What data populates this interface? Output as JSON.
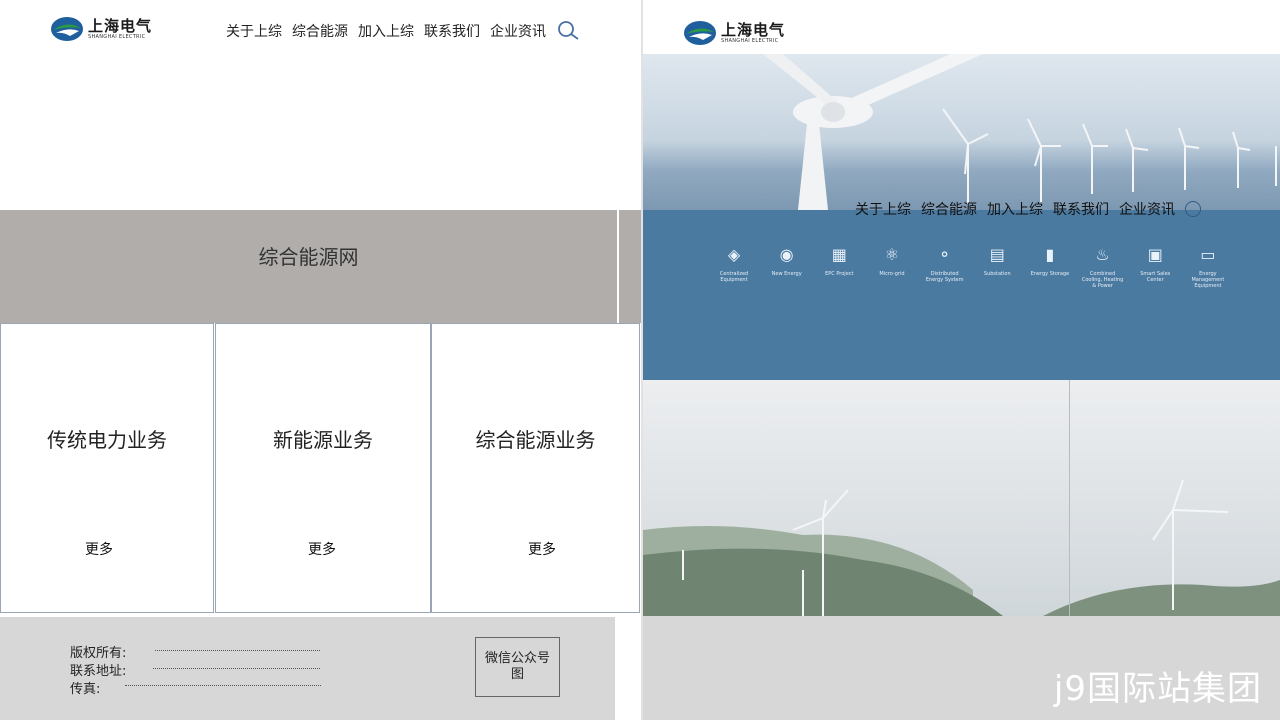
{
  "logo": {
    "cn": "上海电气",
    "en": "SHANGHAI ELECTRIC"
  },
  "nav": {
    "items": [
      "关于上综",
      "综合能源",
      "加入上综",
      "联系我们",
      "企业资讯"
    ]
  },
  "left": {
    "banner_title": "综合能源网",
    "cards": [
      {
        "title": "传统电力业务",
        "more": "更多"
      },
      {
        "title": "新能源业务",
        "more": "更多"
      },
      {
        "title": "综合能源业务",
        "more": "更多"
      }
    ],
    "footer": {
      "copyright_label": "版权所有:",
      "address_label": "联系地址:",
      "fax_label": "传真:",
      "qr_label": "微信公众号图"
    }
  },
  "right": {
    "services": [
      {
        "label": "Centralized Equipment"
      },
      {
        "label": "New Energy"
      },
      {
        "label": "EPC Project"
      },
      {
        "label": "Micro-grid"
      },
      {
        "label": "Distributed Energy System"
      },
      {
        "label": "Substation"
      },
      {
        "label": "Energy Storage"
      },
      {
        "label": "Combined Cooling, Heating & Power"
      },
      {
        "label": "Smart Sales Center"
      },
      {
        "label": "Energy Management Equipment"
      }
    ],
    "watermark": "j9国际站集团"
  },
  "colors": {
    "banner_gray": "#b1adab",
    "blue_band": "#4b7aa1",
    "footer_gray": "#d7d7d7",
    "logo_green": "#2a9a45",
    "logo_blue": "#1f5f9e"
  }
}
